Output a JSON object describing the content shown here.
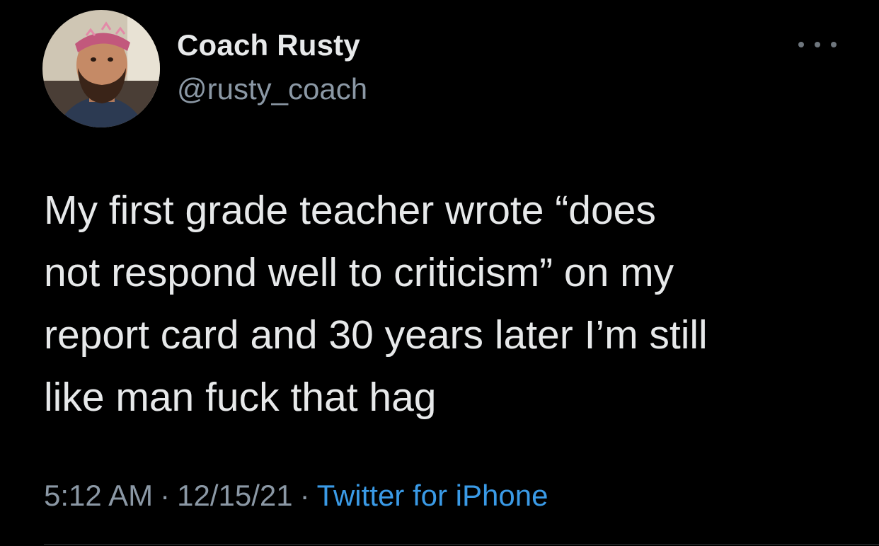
{
  "author": {
    "display_name": "Coach Rusty",
    "handle": "@rusty_coach",
    "avatar_icon": "avatar-photo"
  },
  "menu": {
    "icon": "more-options-icon"
  },
  "tweet": {
    "lines": [
      "My first grade teacher wrote “does",
      "not respond well to criticism” on my",
      "report card and 30 years later I’m still",
      "like man fuck that hag"
    ]
  },
  "meta": {
    "time": "5:12 AM",
    "separator": "·",
    "date": "12/15/21",
    "source": "Twitter for iPhone"
  },
  "colors": {
    "background": "#000000",
    "primary_text": "#e7e9ea",
    "secondary_text": "#8b98a5",
    "link": "#3a9ae6"
  }
}
